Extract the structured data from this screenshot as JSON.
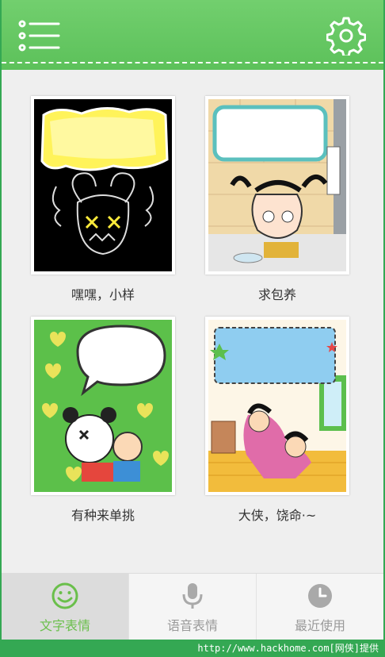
{
  "header": {
    "menu_icon": "menu-list-icon",
    "settings_icon": "gear-icon",
    "color": "#5cc15a"
  },
  "cards": [
    {
      "caption": "嘿嘿，小样"
    },
    {
      "caption": "求包养"
    },
    {
      "caption": "有种来单挑"
    },
    {
      "caption": "大侠，饶命·~"
    }
  ],
  "tabs": [
    {
      "label": "文字表情",
      "icon": "smiley-icon",
      "active": true
    },
    {
      "label": "语音表情",
      "icon": "microphone-icon",
      "active": false
    },
    {
      "label": "最近使用",
      "icon": "clock-icon",
      "active": false
    }
  ],
  "colors": {
    "accent": "#6abf4b",
    "inactive": "#9a9a9a"
  },
  "footer": {
    "text": "http://www.hackhome.com[网侠]提供"
  }
}
